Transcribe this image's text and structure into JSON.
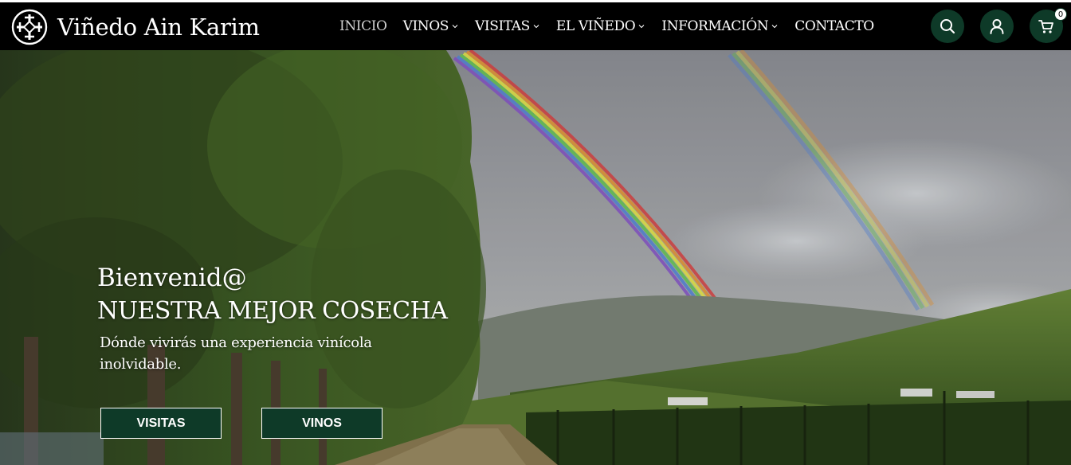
{
  "brand": {
    "name": "Viñedo Ain Karim",
    "accent": "#0e3a28",
    "header_bg": "#000000"
  },
  "nav": {
    "items": [
      {
        "label": "INICIO",
        "has_dropdown": false,
        "active": true
      },
      {
        "label": "VINOS",
        "has_dropdown": true
      },
      {
        "label": "VISITAS",
        "has_dropdown": true
      },
      {
        "label": "EL VIÑEDO",
        "has_dropdown": true
      },
      {
        "label": "INFORMACIÓN",
        "has_dropdown": true
      },
      {
        "label": "CONTACTO",
        "has_dropdown": false
      }
    ]
  },
  "header_actions": {
    "search_icon": "search-icon",
    "account_icon": "user-icon",
    "cart_icon": "cart-icon",
    "cart_count": "0"
  },
  "hero": {
    "greeting": "Bienvenid@",
    "title": "NUESTRA MEJOR COSECHA",
    "subtitle": "Dónde vivirás una experiencia vinícola inolvidable.",
    "buttons": {
      "visitas": "VISITAS",
      "vinos": "VINOS"
    }
  }
}
